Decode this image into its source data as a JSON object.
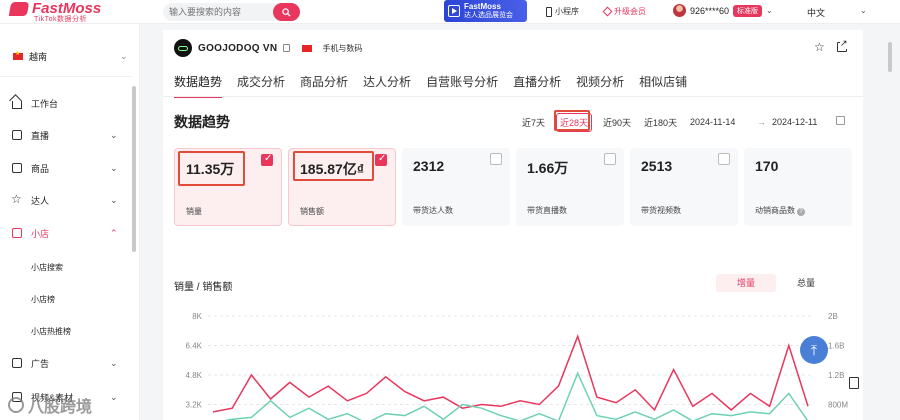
{
  "brand": {
    "name": "FastMoss",
    "tagline": "TikTok数据分析"
  },
  "search": {
    "placeholder": "输入要搜索的内容"
  },
  "promo": {
    "line1": "FastMoss",
    "line2": "达人选品展览会"
  },
  "topbar": {
    "mini_program": "小程序",
    "upgrade": "升级会员",
    "user_phone": "926****60",
    "plan_badge": "标准版",
    "language": "中文"
  },
  "sidebar": {
    "country": "越南",
    "items": [
      {
        "label": "工作台",
        "icon": "home-icon"
      },
      {
        "label": "直播",
        "icon": "live-icon"
      },
      {
        "label": "商品",
        "icon": "product-icon"
      },
      {
        "label": "达人",
        "icon": "star-icon"
      },
      {
        "label": "小店",
        "icon": "shop-icon"
      },
      {
        "label": "广告",
        "icon": "ad-icon"
      },
      {
        "label": "视频&素材",
        "icon": "video-icon"
      }
    ],
    "shop_sub": [
      "小店搜索",
      "小店榜",
      "小店热推榜"
    ]
  },
  "shop": {
    "name": "GOOJODOQ VN",
    "category": "手机与数码"
  },
  "tabs": [
    "数据趋势",
    "成交分析",
    "商品分析",
    "达人分析",
    "自营账号分析",
    "直播分析",
    "视频分析",
    "相似店铺"
  ],
  "section_title": "数据趋势",
  "periods": [
    "近7天",
    "近28天",
    "近90天",
    "近180天"
  ],
  "active_period": "近28天",
  "date_range": {
    "start": "2024-11-14",
    "arrow": "→",
    "end": "2024-12-11"
  },
  "metrics": [
    {
      "value": "11.35万",
      "label": "销量",
      "selected": true
    },
    {
      "value": "185.87亿₫",
      "label": "销售额",
      "selected": true
    },
    {
      "value": "2312",
      "label": "带货达人数",
      "selected": false
    },
    {
      "value": "1.66万",
      "label": "带货直播数",
      "selected": false
    },
    {
      "value": "2513",
      "label": "带货视频数",
      "selected": false
    },
    {
      "value": "170",
      "label": "动销商品数",
      "selected": false
    }
  ],
  "chart_toggle": {
    "on": "增量",
    "off": "总量"
  },
  "colors": {
    "accent": "#e8365d",
    "series_sales_qty": "#e8365d",
    "series_sales_amt": "#6fd1b4",
    "fab": "#4a7fd8"
  },
  "watermark": "八股跨境",
  "chart_data": {
    "type": "line",
    "title": "销量 / 销售额",
    "y_left_ticks": [
      "8K",
      "6.4K",
      "4.8K",
      "3.2K"
    ],
    "y_right_ticks": [
      "2B",
      "1.6B",
      "1.2B",
      "800M"
    ],
    "ylim_left": [
      0,
      8000
    ],
    "ylim_right": [
      0,
      2000000000
    ],
    "series": [
      {
        "values": [
          2800,
          3000,
          4800,
          3500,
          4400,
          3600,
          4200,
          3400,
          3800,
          4700,
          3900,
          3400,
          3600,
          3000,
          3200,
          3100,
          3400,
          3200,
          4200,
          6900,
          3600,
          3300,
          4000,
          2900,
          5100,
          3100,
          3800,
          2900,
          3800,
          3100,
          6400,
          3100
        ]
      },
      {
        "values": [
          2200,
          2400,
          2500,
          3400,
          2500,
          3000,
          2400,
          2700,
          2200,
          2700,
          2600,
          3100,
          2400,
          3200,
          3000,
          2600,
          2300,
          2700,
          2300,
          4900,
          2600,
          2400,
          2800,
          2400,
          2900,
          2300,
          2700,
          2600,
          2800,
          2700,
          3800,
          2300
        ]
      }
    ]
  }
}
